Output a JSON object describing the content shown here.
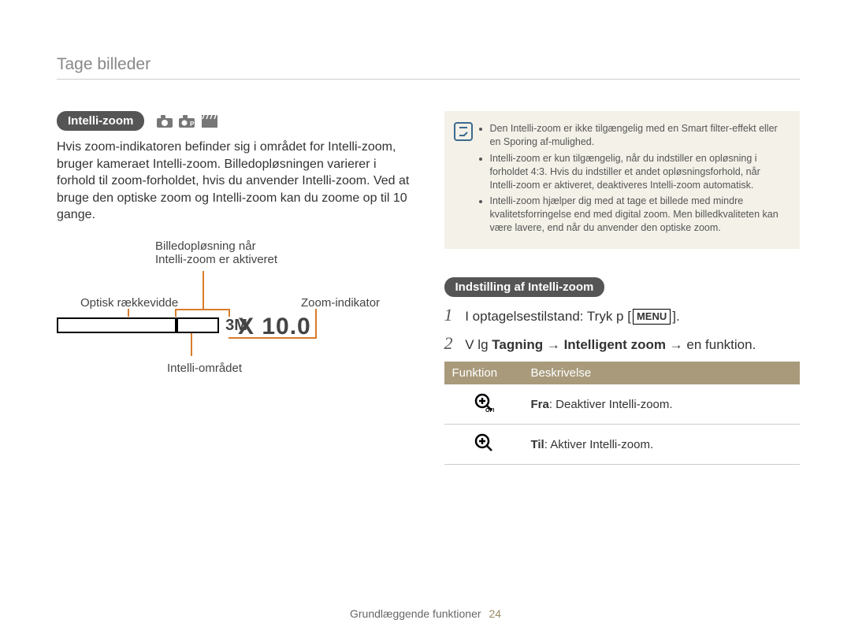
{
  "page_title": "Tage billeder",
  "footer_label": "Grundlæggende funktioner",
  "footer_page": "24",
  "left": {
    "pill": "Intelli-zoom",
    "paragraph": "Hvis zoom-indikatoren befinder sig i området for Intelli-zoom, bruger kameraet Intelli-zoom. Billedopløsningen varierer i forhold til zoom-forholdet, hvis du anvender Intelli-zoom. Ved at bruge den optiske zoom og Intelli-zoom kan du zoome op til 10 gange.",
    "diagram": {
      "top_line1": "Billedopløsning når",
      "top_line2": "Intelli-zoom er aktiveret",
      "left_label": "Optisk rækkevidde",
      "right_label": "Zoom-indikator",
      "bottom_label": "Intelli-området",
      "badge": "3M",
      "zoom_readout": "X 10.0"
    }
  },
  "right": {
    "note_lines": [
      "Den Intelli-zoom er ikke tilgængelig med en Smart filter-effekt eller en Sporing af-mulighed.",
      "Intelli-zoom er kun tilgængelig, når du indstiller en opløsning i forholdet 4:3. Hvis du indstiller et andet opløsningsforhold, når Intelli-zoom er aktiveret, deaktiveres Intelli-zoom automatisk.",
      "Intelli-zoom hjælper dig med at tage et billede med mindre kvalitetsforringelse end med digital zoom. Men billedkvaliteten kan være lavere, end når du anvender den optiske zoom."
    ],
    "pill": "Indstilling af Intelli-zoom",
    "steps": {
      "s1_num": "1",
      "s1_a": "I optagelsestilstand: Tryk p  [",
      "s1_menu": "MENU",
      "s1_b": "].",
      "s2_num": "2",
      "s2_a": "V lg ",
      "s2_b": "Tagning",
      "s2_c": " → ",
      "s2_d": "Intelligent zoom",
      "s2_e": " → en funktion."
    },
    "table": {
      "h1": "Funktion",
      "h2": "Beskrivelse",
      "r1_strong": "Fra",
      "r1_rest": ": Deaktiver Intelli-zoom.",
      "r2_strong": "Til",
      "r2_rest": ": Aktiver Intelli-zoom."
    }
  }
}
